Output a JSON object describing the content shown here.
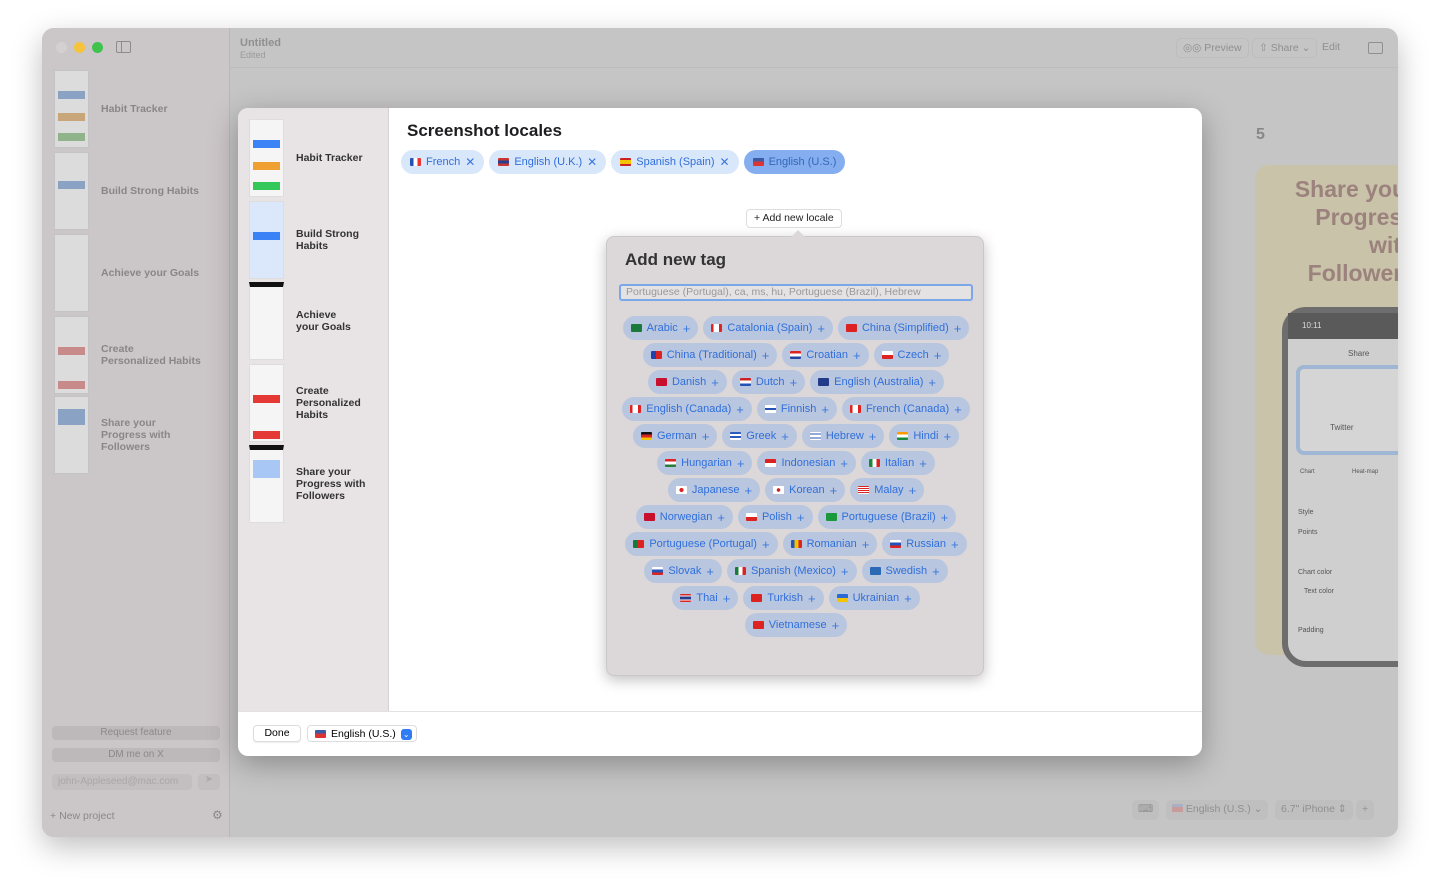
{
  "window": {
    "title": "Untitled",
    "subtitle": "Edited"
  },
  "toolbar": {
    "preview": "Preview",
    "share": "Share",
    "edit": "Edit"
  },
  "sidebar": {
    "items": [
      {
        "label": "Habit Tracker"
      },
      {
        "label": "Build Strong Habits"
      },
      {
        "label": "Achieve your Goals"
      },
      {
        "label": "Create Personalized Habits"
      },
      {
        "label": "Share your Progress with Followers"
      }
    ],
    "request_feature": "Request feature",
    "dm": "DM me on X",
    "email_placeholder": "john-Appleseed@mac.com",
    "new_project": "New project"
  },
  "canvas": {
    "page_number": "5",
    "card_title": "Share your Progress with Followers",
    "phone_time": "10:11",
    "phone_screen_title": "Share",
    "phone_item": "Twitter",
    "phone_tabs": [
      "Chart",
      "Heat-map"
    ],
    "phone_options": [
      "Style",
      "Points",
      "Chart color",
      "Text color",
      "Padding"
    ]
  },
  "bottombar": {
    "locale": "English (U.S.)",
    "device": "6.7\" iPhone"
  },
  "modal": {
    "title": "Screenshot locales",
    "screens": [
      {
        "label": "Habit Tracker"
      },
      {
        "label": "Build Strong Habits"
      },
      {
        "label": "Achieve your Goals"
      },
      {
        "label": "Create Personalized Habits"
      },
      {
        "label": "Share your Progress with Followers"
      }
    ],
    "locales": [
      {
        "label": "French",
        "flag": "fr"
      },
      {
        "label": "English (U.K.)",
        "flag": "gb"
      },
      {
        "label": "Spanish (Spain)",
        "flag": "es"
      },
      {
        "label": "English (U.S.)",
        "flag": "us",
        "selected": true
      }
    ],
    "add_locale": "Add new locale",
    "done": "Done",
    "current_locale": "English (U.S.)"
  },
  "popover": {
    "title": "Add new tag",
    "placeholder": "Portuguese (Portugal), ca, ms, hu, Portuguese (Brazil), Hebrew",
    "tags": [
      {
        "label": "Arabic",
        "flag": "sa"
      },
      {
        "label": "Catalonia (Spain)",
        "flag": "ca"
      },
      {
        "label": "China (Simplified)",
        "flag": "cn"
      },
      {
        "label": "China (Traditional)",
        "flag": "tw"
      },
      {
        "label": "Croatian",
        "flag": "hr"
      },
      {
        "label": "Czech",
        "flag": "cz"
      },
      {
        "label": "Danish",
        "flag": "dk"
      },
      {
        "label": "Dutch",
        "flag": "nl"
      },
      {
        "label": "English (Australia)",
        "flag": "au"
      },
      {
        "label": "English (Canada)",
        "flag": "ca"
      },
      {
        "label": "Finnish",
        "flag": "fi"
      },
      {
        "label": "French (Canada)",
        "flag": "ca"
      },
      {
        "label": "German",
        "flag": "de"
      },
      {
        "label": "Greek",
        "flag": "gr"
      },
      {
        "label": "Hebrew",
        "flag": "il"
      },
      {
        "label": "Hindi",
        "flag": "in"
      },
      {
        "label": "Hungarian",
        "flag": "hu"
      },
      {
        "label": "Indonesian",
        "flag": "id"
      },
      {
        "label": "Italian",
        "flag": "it"
      },
      {
        "label": "Japanese",
        "flag": "jp"
      },
      {
        "label": "Korean",
        "flag": "kr"
      },
      {
        "label": "Malay",
        "flag": "my"
      },
      {
        "label": "Norwegian",
        "flag": "no"
      },
      {
        "label": "Polish",
        "flag": "pl"
      },
      {
        "label": "Portuguese (Brazil)",
        "flag": "br"
      },
      {
        "label": "Portuguese (Portugal)",
        "flag": "pt"
      },
      {
        "label": "Romanian",
        "flag": "ro"
      },
      {
        "label": "Russian",
        "flag": "ru"
      },
      {
        "label": "Slovak",
        "flag": "sk"
      },
      {
        "label": "Spanish (Mexico)",
        "flag": "mx"
      },
      {
        "label": "Swedish",
        "flag": "se"
      },
      {
        "label": "Thai",
        "flag": "th"
      },
      {
        "label": "Turkish",
        "flag": "tr"
      },
      {
        "label": "Ukrainian",
        "flag": "ua"
      },
      {
        "label": "Vietnamese",
        "flag": "vn"
      }
    ]
  },
  "colors": {
    "accent": "#2f7cf6",
    "chip_bg": "#d9e7fb",
    "chip_selected": "#84aef0",
    "tag_bg": "#b9c6df"
  }
}
